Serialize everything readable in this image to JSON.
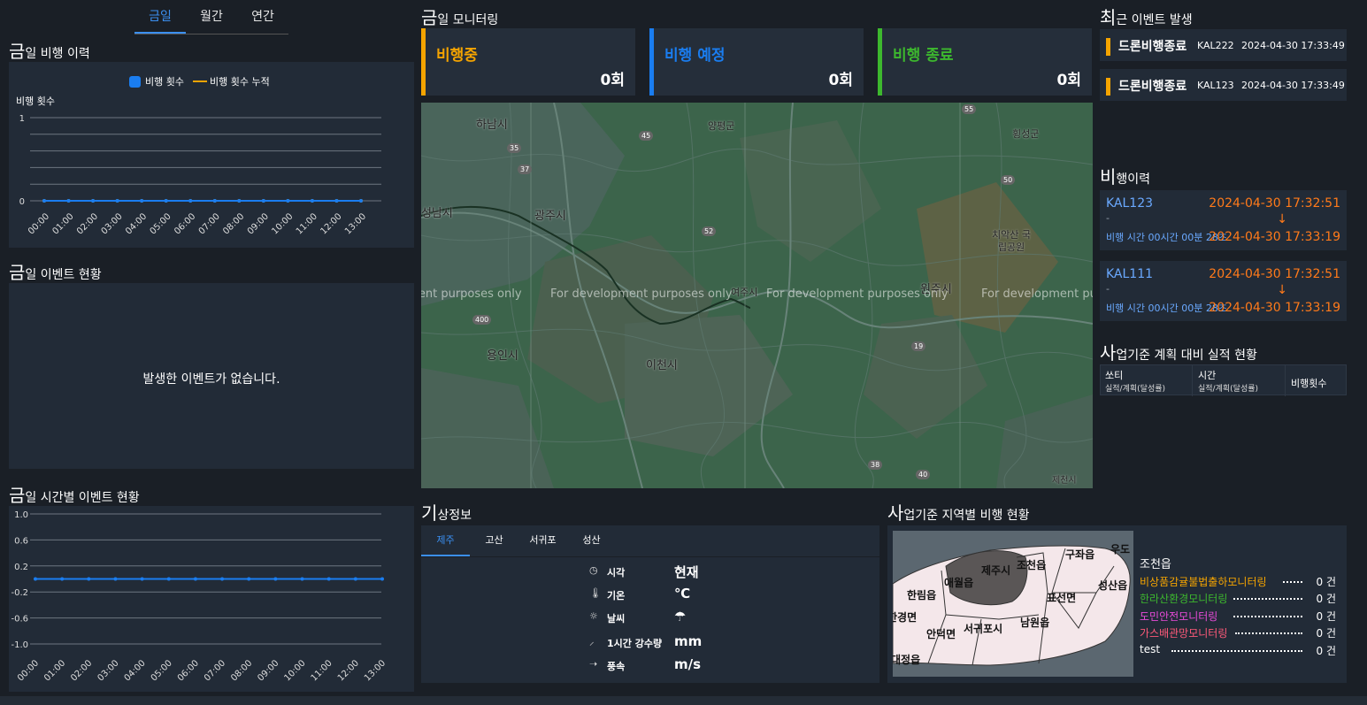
{
  "period_tabs": [
    "금일",
    "월간",
    "연간"
  ],
  "daily_flight": {
    "title_first": "금",
    "title_rest": "일 비행 이력",
    "legend": [
      "비행 횟수",
      "비행 횟수 누적"
    ],
    "ylabel": "비행 횟수"
  },
  "daily_event": {
    "title_first": "금",
    "title_rest": "일 이벤트 현황",
    "empty_message": "발생한 이벤트가 없습니다."
  },
  "hourly_event": {
    "title_first": "금",
    "title_rest": "일 시간별 이벤트 현황"
  },
  "monitoring": {
    "title_first": "금",
    "title_rest": "일 모니터링",
    "cards": [
      {
        "label": "비행중",
        "value": "0회",
        "color": "#f5a400"
      },
      {
        "label": "비행 예정",
        "value": "0회",
        "color": "#1a7df0"
      },
      {
        "label": "비행 종료",
        "value": "0회",
        "color": "#3db82e"
      }
    ]
  },
  "map": {
    "watermark": "For development purposes only",
    "places": [
      "하남시",
      "양평군",
      "횡성군",
      "성남시",
      "광주시",
      "치악산 국립공원",
      "여주시",
      "원주시",
      "용인시",
      "이천시",
      "제천시"
    ],
    "routes": [
      "45",
      "35",
      "37",
      "52",
      "50",
      "55",
      "40",
      "19",
      "38",
      "400"
    ]
  },
  "recent_events": {
    "title_first": "최",
    "title_rest": "근 이벤트 발생",
    "items": [
      {
        "title": "드론비행종료",
        "code": "KAL222",
        "time": "2024-04-30 17:33:49"
      },
      {
        "title": "드론비행종료",
        "code": "KAL123",
        "time": "2024-04-30 17:33:49"
      }
    ]
  },
  "flight_history": {
    "title_first": "비",
    "title_rest": "행이력",
    "items": [
      {
        "code": "KAL123",
        "dash": "-",
        "duration": "비행 시간 00시간 00분 28초",
        "start": "2024-04-30 17:32:51",
        "arrow": "↓",
        "end": "2024-04-30 17:33:19"
      },
      {
        "code": "KAL111",
        "dash": "-",
        "duration": "비행 시간 00시간 00분 28초",
        "start": "2024-04-30 17:32:51",
        "arrow": "↓",
        "end": "2024-04-30 17:33:19"
      }
    ]
  },
  "plan_vs_actual": {
    "title_first": "사",
    "title_rest": "업기준 계획 대비 실적 현황",
    "col1": "쏘티",
    "col1_sub": "실적/계획(달성률)",
    "col2": "시간",
    "col2_sub": "실적/계획(달성률)",
    "col3": "비행횟수"
  },
  "weather": {
    "title_first": "기",
    "title_rest": "상정보",
    "tabs": [
      "제주",
      "고산",
      "서귀포",
      "성산"
    ],
    "rows": [
      {
        "icon": "◷",
        "name": "시각",
        "value": "현재"
      },
      {
        "icon": "🌡",
        "name": "기온",
        "value": "℃"
      },
      {
        "icon": "☼",
        "name": "날씨",
        "value": "☂"
      },
      {
        "icon": "⸝",
        "name": "1시간 강수량",
        "value": "mm"
      },
      {
        "icon": "➝",
        "name": "풍속",
        "value": "m/s"
      }
    ]
  },
  "regional": {
    "title_first": "사",
    "title_rest": "업기준 지역별 비행 현황",
    "map_labels": [
      "제주시",
      "조천읍",
      "구좌읍",
      "우도",
      "애월읍",
      "한림읍",
      "성산읍",
      "표선면",
      "한경면",
      "안덕면",
      "서귀포시",
      "남원읍",
      "대정읍"
    ],
    "selected": "조천읍",
    "stats": [
      {
        "name": "비상품감귤불법출하모니터링",
        "value": "0 건",
        "color": "#f5a400"
      },
      {
        "name": "한라산환경모니터링",
        "value": "0 건",
        "color": "#3db82e"
      },
      {
        "name": "도민안전모니터링",
        "value": "0 건",
        "color": "#e84bd8"
      },
      {
        "name": "가스배관망모니터링",
        "value": "0 건",
        "color": "#ff5a7a"
      },
      {
        "name": "test",
        "value": "0 건",
        "color": "#ffffff"
      }
    ]
  },
  "chart_data": [
    {
      "type": "line",
      "title": "",
      "ylabel": "비행 횟수",
      "x": [
        "00:00",
        "01:00",
        "02:00",
        "03:00",
        "04:00",
        "05:00",
        "06:00",
        "07:00",
        "08:00",
        "09:00",
        "10:00",
        "11:00",
        "12:00",
        "13:00"
      ],
      "series": [
        {
          "name": "비행 횟수",
          "values": [
            0,
            0,
            0,
            0,
            0,
            0,
            0,
            0,
            0,
            0,
            0,
            0,
            0,
            0
          ],
          "color": "#1a7df0"
        },
        {
          "name": "비행 횟수 누적",
          "values": [
            0,
            0,
            0,
            0,
            0,
            0,
            0,
            0,
            0,
            0,
            0,
            0,
            0,
            0
          ],
          "color": "#f5a400"
        }
      ],
      "yticks": [
        0,
        1
      ],
      "ylim": [
        0,
        1
      ],
      "grid": true,
      "legend": "top-center"
    },
    {
      "type": "line",
      "title": "",
      "x": [
        "00:00",
        "01:00",
        "02:00",
        "03:00",
        "04:00",
        "05:00",
        "06:00",
        "07:00",
        "08:00",
        "09:00",
        "10:00",
        "11:00",
        "12:00",
        "13:00"
      ],
      "series": [
        {
          "values": [
            0,
            0,
            0,
            0,
            0,
            0,
            0,
            0,
            0,
            0,
            0,
            0,
            0,
            0
          ],
          "color": "#1a7df0"
        }
      ],
      "yticks": [
        "1.0",
        "0.6",
        "0.2",
        "-0.2",
        "-0.6",
        "-1.0"
      ],
      "ylim": [
        -1,
        1
      ],
      "grid": true
    }
  ]
}
